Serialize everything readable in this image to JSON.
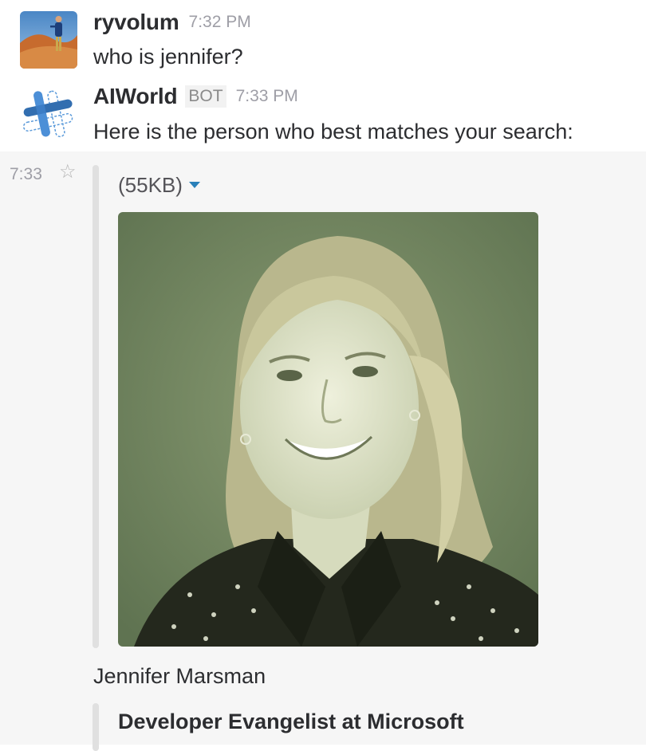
{
  "messages": [
    {
      "sender": "ryvolum",
      "time": "7:32 PM",
      "text": "who is jennifer?",
      "avatar_icon": "desert-portrait-avatar"
    },
    {
      "sender": "AIWorld",
      "badge": "BOT",
      "time": "7:33 PM",
      "text": "Here is the person who best matches your search:",
      "avatar_icon": "hashtag-logo-avatar"
    }
  ],
  "attachment": {
    "hover_time": "7:33",
    "star_icon": "star-outline-icon",
    "file_size": "(55KB)",
    "dropdown_icon": "caret-down-icon",
    "caption": "Jennifer Marsman",
    "title": "Developer Evangelist at Microsoft"
  },
  "colors": {
    "accent": "#2a80b9",
    "photo_tint": "#7d9068",
    "hover_bg": "#f6f6f6"
  }
}
